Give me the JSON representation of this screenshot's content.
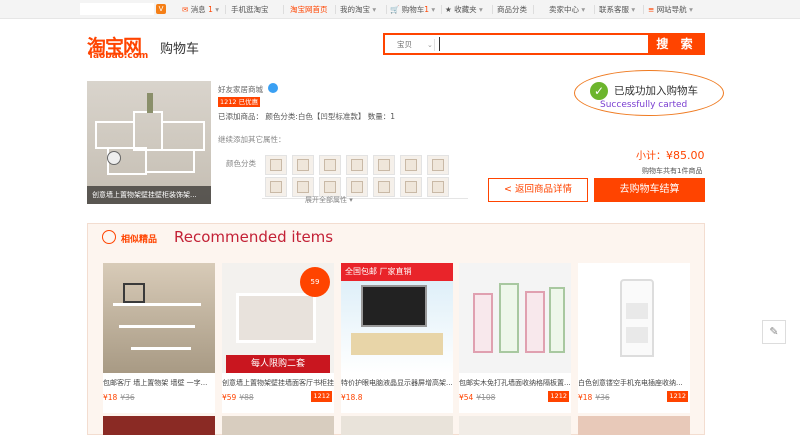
{
  "topbar": {
    "messages_label": "消息",
    "messages_count": "1",
    "mobile": "手机逛淘宝",
    "home": "淘宝网首页",
    "my_taobao": "我的淘宝",
    "cart_label": "购物车",
    "cart_count": "1",
    "favorites": "收藏夹",
    "categories": "商品分类",
    "seller_center": "卖家中心",
    "contact": "联系客服",
    "site_nav": "网站导航"
  },
  "header": {
    "logo_cn": "淘宝网",
    "logo_en": "Taobao.com",
    "page_title": "购物车",
    "search_category": "宝贝",
    "search_value": "",
    "search_button": "搜 索"
  },
  "product": {
    "image_caption": "创意墙上置物架壁挂壁柜装饰架...",
    "shop_name": "好友家居商城",
    "promo_tag": "1212 已优惠",
    "added_line": "已添加商品：   颜色分类:白色【凹型标准款】   数量：1",
    "other_attrs": "继续添加其它属性：",
    "color_label": "颜色分类",
    "more_attrs": "展开全部属性 ▾"
  },
  "success": {
    "message": "已成功加入购物车",
    "message_en": "Successfully carted",
    "subtotal_label": "小计：",
    "subtotal_value": "¥85.00",
    "cart_count_text": "购物车共有1件商品",
    "back_button": "< 返回商品详情",
    "checkout_button": "去购物车结算"
  },
  "recommended": {
    "title_cn": "相似精品",
    "title_en": "Recommended items",
    "items": [
      {
        "title": "包邮客厅 墙上置物架 墙壁 一字...",
        "price": "¥18",
        "orig": "¥36",
        "badge": ""
      },
      {
        "title": "创意墙上置物架壁挂墙面客厅书柜挂...",
        "price": "¥59",
        "orig": "¥88",
        "badge": "1212"
      },
      {
        "title": "特价护眼电脑液晶显示器屏增高架...",
        "price": "¥18.8",
        "orig": "",
        "badge": ""
      },
      {
        "title": "包邮实木免打孔墙面收纳格隔板置...",
        "price": "¥54",
        "orig": "¥108",
        "badge": "1212"
      },
      {
        "title": "白色创意镂空手机充电插座收纳...",
        "price": "¥18",
        "orig": "¥36",
        "badge": "1212"
      }
    ]
  },
  "icons": {
    "edit": "pencil-icon",
    "check": "check-circle-icon"
  },
  "colors": {
    "accent": "#ff4400",
    "success": "#6cb52d",
    "highlight_ring": "#ef7a20"
  }
}
